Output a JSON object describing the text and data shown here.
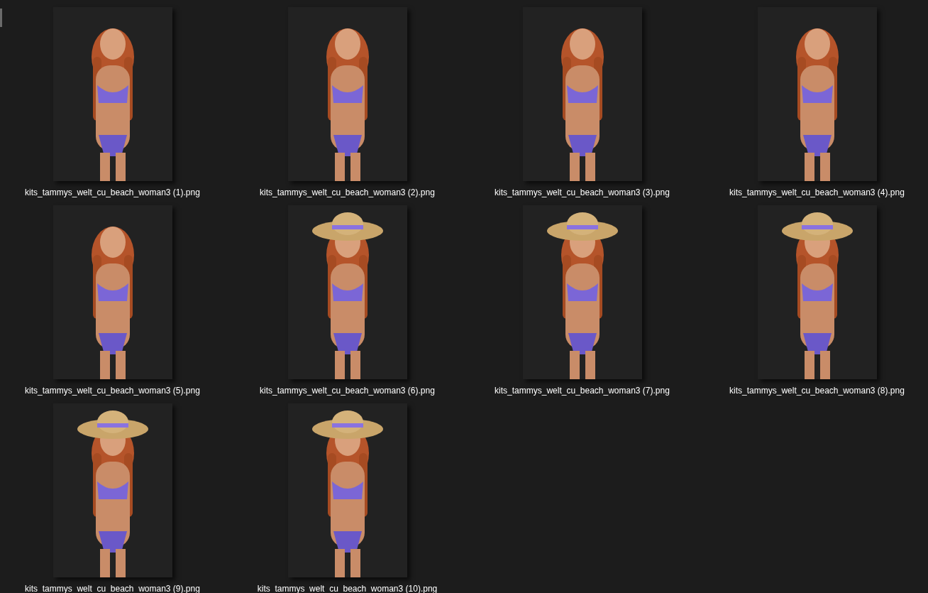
{
  "files": [
    {
      "name": "kits_tammys_welt_cu_beach_woman3 (1).png",
      "kind": "picture"
    },
    {
      "name": "kits_tammys_welt_cu_beach_woman3 (2).png",
      "kind": "picture"
    },
    {
      "name": "kits_tammys_welt_cu_beach_woman3 (3).png",
      "kind": "picture"
    },
    {
      "name": "kits_tammys_welt_cu_beach_woman3 (4).png",
      "kind": "picture"
    },
    {
      "name": "kits_tammys_welt_cu_beach_woman3 (5).png",
      "kind": "picture"
    },
    {
      "name": "kits_tammys_welt_cu_beach_woman3 (6).png",
      "kind": "picture"
    },
    {
      "name": "kits_tammys_welt_cu_beach_woman3 (7).png",
      "kind": "picture"
    },
    {
      "name": "kits_tammys_welt_cu_beach_woman3 (8).png",
      "kind": "picture"
    },
    {
      "name": "kits_tammys_welt_cu_beach_woman3 (9).png",
      "kind": "picture"
    },
    {
      "name": "kits_tammys_welt_cu_beach_woman3 (10).png",
      "kind": "picture"
    }
  ]
}
